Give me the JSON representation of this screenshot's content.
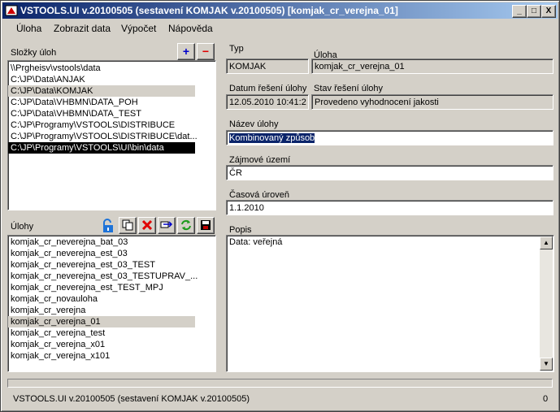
{
  "window": {
    "title": "VSTOOLS.UI v.20100505 (sestavení KOMJAK v.20100505) [komjak_cr_verejna_01]",
    "controls": {
      "minimize": "_",
      "maximize": "□",
      "close": "X"
    }
  },
  "menu": [
    "Úloha",
    "Zobrazit data",
    "Výpočet",
    "Nápověda"
  ],
  "folders": {
    "label": "Složky úloh",
    "add": "+",
    "remove": "−",
    "items": [
      "\\\\Prgheisv\\vstools\\data",
      "C:\\JP\\Data\\ANJAK",
      "C:\\JP\\Data\\KOMJAK",
      "C:\\JP\\Data\\VHBMN\\DATA_POH",
      "C:\\JP\\Data\\VHBMN\\DATA_TEST",
      "C:\\JP\\Programy\\VSTOOLS\\DISTRIBUCE",
      "C:\\JP\\Programy\\VSTOOLS\\DISTRIBUCE\\dat...",
      "C:\\JP\\Programy\\VSTOOLS\\UI\\bin\\data"
    ]
  },
  "tasks": {
    "label": "Úlohy",
    "items": [
      "komjak_cr_neverejna_bat_03",
      "komjak_cr_neverejna_est_03",
      "komjak_cr_neverejna_est_03_TEST",
      "komjak_cr_neverejna_est_03_TESTUPRAV_...",
      "komjak_cr_neverejna_est_TEST_MPJ",
      "komjak_cr_novauloha",
      "komjak_cr_verejna",
      "komjak_cr_verejna_01",
      "komjak_cr_verejna_test",
      "komjak_cr_verejna_x01",
      "komjak_cr_verejna_x101"
    ]
  },
  "details": {
    "typ_label": "Typ",
    "typ_value": "KOMJAK",
    "uloha_label": "Úloha",
    "uloha_value": "komjak_cr_verejna_01",
    "datum_label": "Datum řešení úlohy",
    "datum_value": "12.05.2010 10:41:2",
    "stav_label": "Stav řešení úlohy",
    "stav_value": "Provedeno vyhodnocení jakosti",
    "nazev_label": "Název úlohy",
    "nazev_value": "Kombinovaný způsob",
    "zajmove_label": "Zájmové území",
    "zajmove_value": "ČR",
    "casova_label": "Časová úroveň",
    "casova_value": "1.1.2010",
    "popis_label": "Popis",
    "popis_value": "Data: veřejná"
  },
  "status": {
    "text": "VSTOOLS.UI v.20100505 (sestavení KOMJAK v.20100505)",
    "count": "0"
  }
}
